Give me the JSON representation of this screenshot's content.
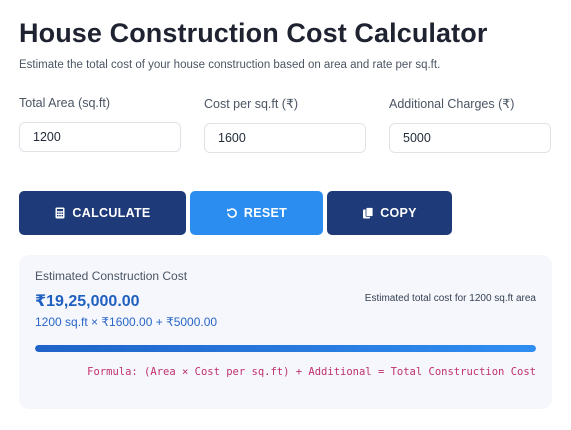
{
  "header": {
    "title": "House Construction Cost Calculator",
    "subtitle": "Estimate the total cost of your house construction based on area and rate per sq.ft."
  },
  "form": {
    "fields": [
      {
        "label": "Total Area (sq.ft)",
        "value": "1200"
      },
      {
        "label": "Cost per sq.ft (₹)",
        "value": "1600"
      },
      {
        "label": "Additional Charges (₹)",
        "value": "5000"
      }
    ]
  },
  "actions": {
    "calculate": {
      "label": "CALCULATE",
      "icon": "calculator-icon",
      "color": "#1f3a78"
    },
    "reset": {
      "label": "RESET",
      "icon": "reset-icon",
      "color": "#2b8df0"
    },
    "copy": {
      "label": "COPY",
      "icon": "copy-icon",
      "color": "#1f3a78"
    }
  },
  "result": {
    "label": "Estimated Construction Cost",
    "total": "₹19,25,000.00",
    "note": "Estimated total cost for 1200 sq.ft area",
    "breakdown": "1200 sq.ft × ₹1600.00 + ₹5000.00",
    "progress": 1.0,
    "formula": "Formula: (Area × Cost per sq.ft) + Additional = Total Construction Cost"
  },
  "colors": {
    "accent_dark": "#1f3a78",
    "accent_light": "#2b8df0",
    "result_total": "#1f5fc0",
    "formula": "#c0306e"
  }
}
